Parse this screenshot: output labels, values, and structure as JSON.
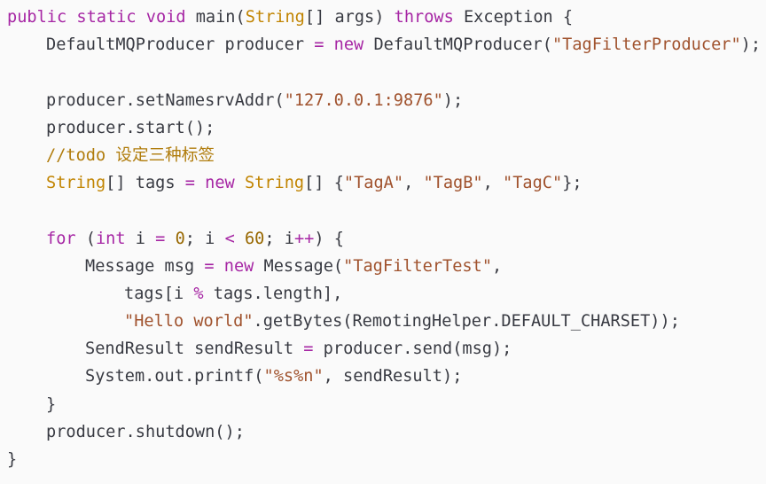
{
  "code": {
    "kw_public": "public",
    "kw_static": "static",
    "kw_void": "void",
    "main_sig_a": " main(",
    "type_string": "String",
    "main_sig_b": "[] args) ",
    "kw_throws": "throws",
    "main_sig_c": " Exception {",
    "l2_a": "DefaultMQProducer producer ",
    "eq": "=",
    "kw_new": "new",
    "l2_b": " DefaultMQProducer(",
    "l2_str": "\"TagFilterProducer\"",
    "l2_c": ");",
    "l4_a": "producer.setNamesrvAddr(",
    "l4_str": "\"127.0.0.1:9876\"",
    "l4_b": ");",
    "l5": "producer.start();",
    "l6_comment_prefix": "//todo ",
    "l6_comment_cjk": "设定三种标签",
    "l7_type": "String",
    "l7_a": "[] tags ",
    "l7_type2": "String",
    "l7_b": "[] {",
    "l7_s1": "\"TagA\"",
    "comma": ", ",
    "l7_s2": "\"TagB\"",
    "l7_s3": "\"TagC\"",
    "l7_c": "};",
    "kw_for": "for",
    "l9_a": " (",
    "kw_int": "int",
    "l9_b": " i ",
    "num_0": "0",
    "l9_c": "; i ",
    "lt": "<",
    "num_60": "60",
    "l9_d": "; i",
    "pp": "++",
    "l9_e": ") {",
    "l10_a": "Message msg ",
    "l10_b": " Message(",
    "l10_str": "\"TagFilterTest\"",
    "l10_c": ",",
    "l11_a": "tags[i ",
    "mod": "%",
    "l11_b": " tags.length],",
    "l12_str": "\"Hello world\"",
    "l12_a": ".getBytes(RemotingHelper.DEFAULT_CHARSET));",
    "l13_a": "SendResult sendResult ",
    "l13_b": " producer.send(msg);",
    "l14_a": "System.out.printf(",
    "l14_str": "\"%s%n\"",
    "l14_b": ", sendResult);",
    "close_brace": "}",
    "l16": "producer.shutdown();"
  }
}
